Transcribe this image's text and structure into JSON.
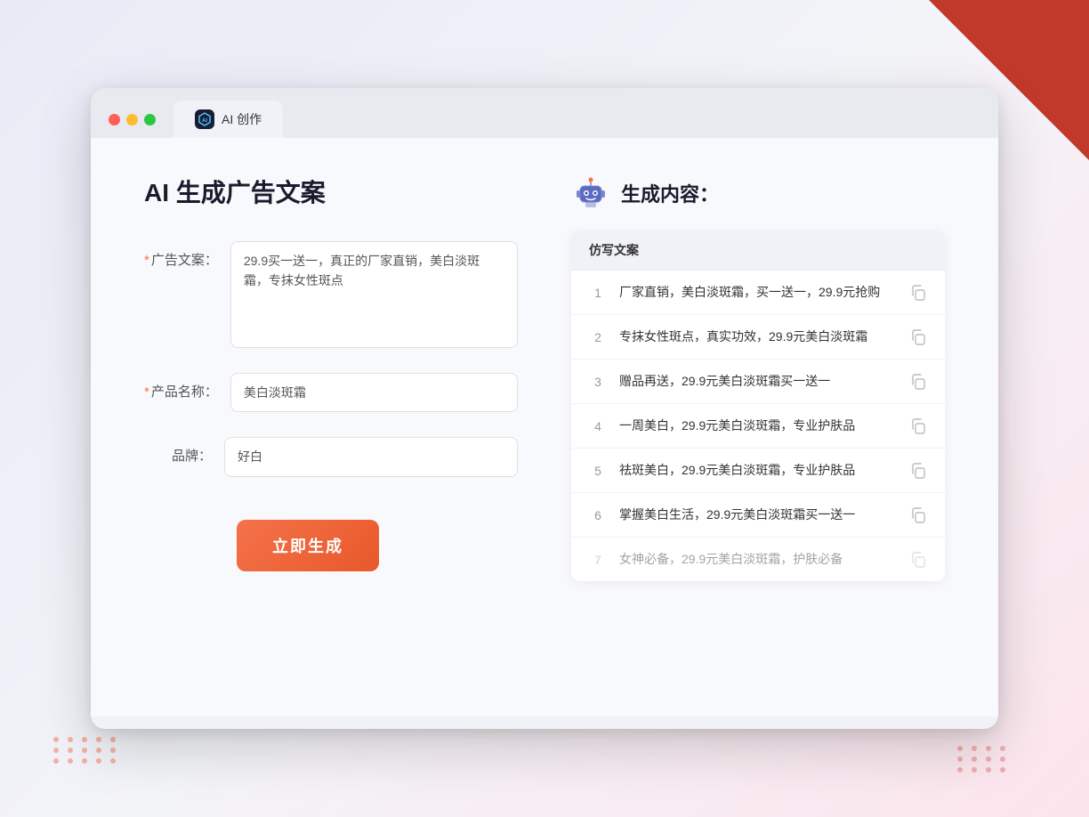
{
  "decorative": {
    "triangle_color": "#c0392b",
    "dot_color": "#f4724a"
  },
  "browser": {
    "tab_label": "AI 创作",
    "tab_icon_text": "AI"
  },
  "left_panel": {
    "page_title": "AI 生成广告文案",
    "form": {
      "ad_copy_label": "广告文案：",
      "ad_copy_required": "*",
      "ad_copy_value": "29.9买一送一，真正的厂家直销，美白淡斑霜，专抹女性斑点",
      "product_name_label": "产品名称：",
      "product_name_required": "*",
      "product_name_value": "美白淡斑霜",
      "brand_label": "品牌：",
      "brand_value": "好白",
      "generate_btn_label": "立即生成"
    }
  },
  "right_panel": {
    "result_title": "生成内容：",
    "table_header": "仿写文案",
    "rows": [
      {
        "num": "1",
        "text": "厂家直销，美白淡斑霜，买一送一，29.9元抢购",
        "faded": false
      },
      {
        "num": "2",
        "text": "专抹女性斑点，真实功效，29.9元美白淡斑霜",
        "faded": false
      },
      {
        "num": "3",
        "text": "赠品再送，29.9元美白淡斑霜买一送一",
        "faded": false
      },
      {
        "num": "4",
        "text": "一周美白，29.9元美白淡斑霜，专业护肤品",
        "faded": false
      },
      {
        "num": "5",
        "text": "祛斑美白，29.9元美白淡斑霜，专业护肤品",
        "faded": false
      },
      {
        "num": "6",
        "text": "掌握美白生活，29.9元美白淡斑霜买一送一",
        "faded": false
      },
      {
        "num": "7",
        "text": "女神必备，29.9元美白淡斑霜，护肤必备",
        "faded": true
      }
    ]
  }
}
